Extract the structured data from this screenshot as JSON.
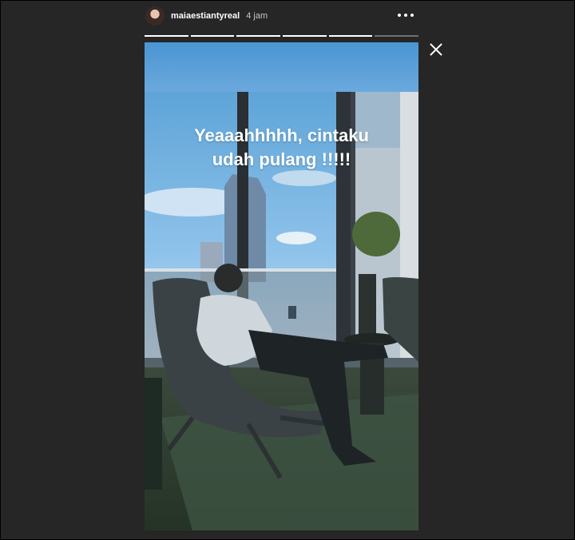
{
  "story": {
    "username": "maiaestiantyreal",
    "time": "4 jam",
    "caption_line1": "Yeaaahhhhh, cintaku",
    "caption_line2": "udah pulang !!!!!",
    "progress_segments": 6,
    "progress_completed": 5
  },
  "icons": {
    "more": "more-horizontal-icon",
    "close": "close-icon",
    "avatar": "profile-avatar"
  }
}
